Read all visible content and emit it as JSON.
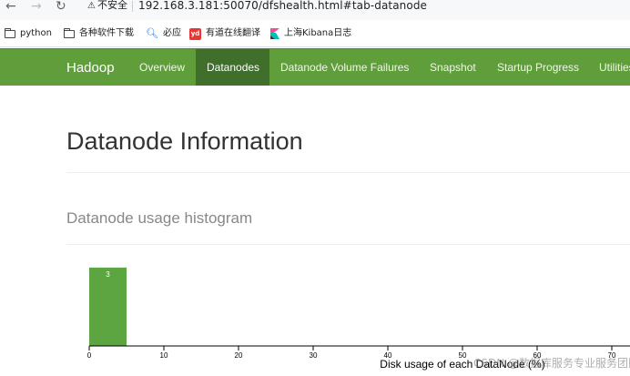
{
  "browser": {
    "security_label": "不安全",
    "url": "192.168.3.181:50070/dfshealth.html#tab-datanode"
  },
  "bookmarks": [
    {
      "label": "python",
      "icon": "folder-icon"
    },
    {
      "label": "各种软件下载",
      "icon": "folder-icon"
    },
    {
      "label": "必应",
      "icon": "search-icon"
    },
    {
      "label": "有道在线翻译",
      "icon": "youdao-icon"
    },
    {
      "label": "上海Kibana日志",
      "icon": "kibana-icon"
    }
  ],
  "navbar": {
    "brand": "Hadoop",
    "items": [
      {
        "label": "Overview",
        "active": false
      },
      {
        "label": "Datanodes",
        "active": true
      },
      {
        "label": "Datanode Volume Failures",
        "active": false
      },
      {
        "label": "Snapshot",
        "active": false
      },
      {
        "label": "Startup Progress",
        "active": false
      },
      {
        "label": "Utilities",
        "active": false
      }
    ],
    "colors": {
      "bar": "#5f9e3a",
      "active": "#3f6f2b"
    }
  },
  "main": {
    "title": "Datanode Information",
    "histogram_title": "Datanode usage histogram"
  },
  "watermark": "CSDN @数据库服务专业服务团队",
  "chart_data": {
    "type": "bar",
    "bins": [
      [
        0,
        5
      ]
    ],
    "values": [
      3
    ],
    "bar_labels": [
      "3"
    ],
    "xlabel": "Disk usage of each DataNode (%)",
    "xticks": [
      0,
      10,
      20,
      30,
      40,
      50,
      60,
      70
    ],
    "xlim": [
      0,
      72
    ],
    "ylim": [
      0,
      3.3
    ],
    "bar_color": "#5da540"
  }
}
